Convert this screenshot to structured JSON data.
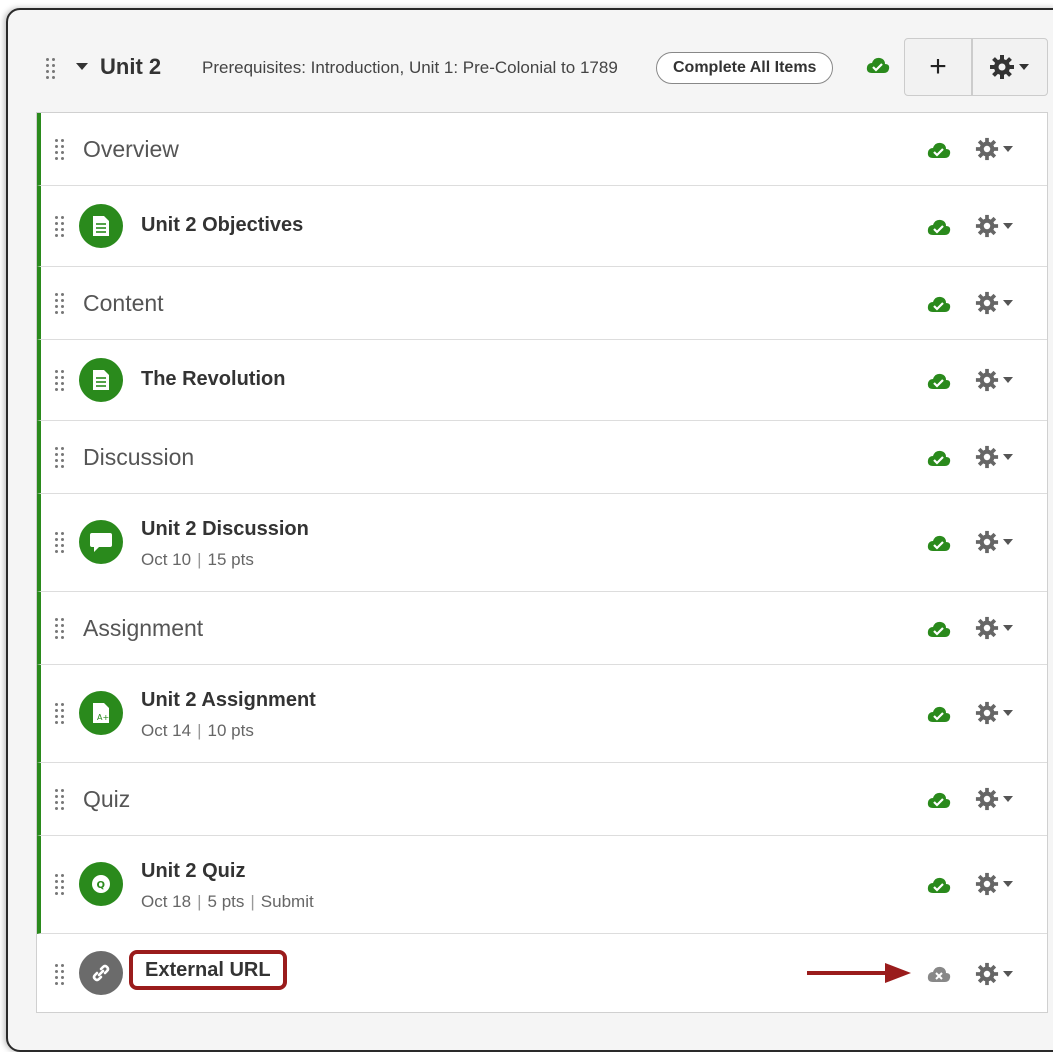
{
  "module": {
    "title": "Unit 2",
    "prerequisites": "Prerequisites: Introduction, Unit 1: Pre-Colonial to 1789",
    "complete_all_label": "Complete All Items",
    "add_label": "+",
    "published_color": "#2a8a1c",
    "unpublished_color": "#888888"
  },
  "items": [
    {
      "kind": "header",
      "title": "Overview"
    },
    {
      "kind": "page",
      "icon": "page-icon",
      "title": "Unit 2 Objectives"
    },
    {
      "kind": "header",
      "title": "Content"
    },
    {
      "kind": "page",
      "icon": "page-icon",
      "title": "The Revolution"
    },
    {
      "kind": "header",
      "title": "Discussion"
    },
    {
      "kind": "discussion",
      "icon": "discussion-icon",
      "title": "Unit 2 Discussion",
      "date": "Oct 10",
      "points": "15 pts"
    },
    {
      "kind": "header",
      "title": "Assignment"
    },
    {
      "kind": "assignment",
      "icon": "assignment-icon",
      "title": "Unit 2 Assignment",
      "date": "Oct 14",
      "points": "10 pts"
    },
    {
      "kind": "header",
      "title": "Quiz"
    },
    {
      "kind": "quiz",
      "icon": "quiz-icon",
      "title": "Unit 2 Quiz",
      "date": "Oct 18",
      "points": "5 pts",
      "extra": "Submit"
    },
    {
      "kind": "external-url",
      "icon": "link-icon",
      "title": "External URL",
      "published": false
    }
  ],
  "separator": "|"
}
